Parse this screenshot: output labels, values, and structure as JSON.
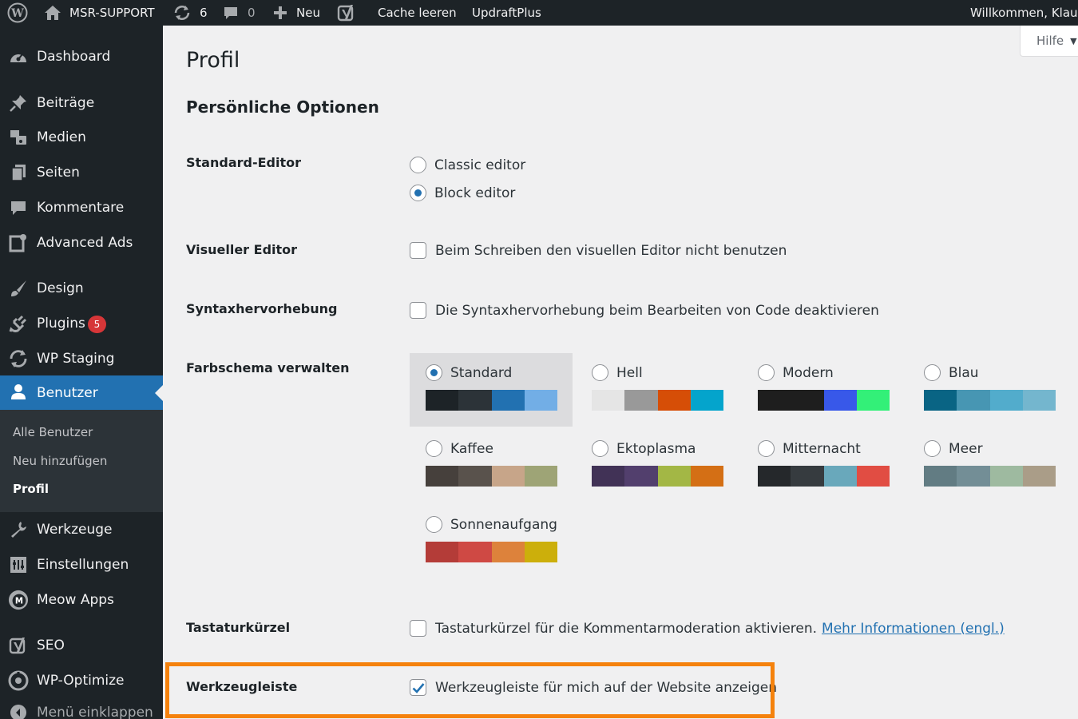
{
  "adminbar": {
    "site_name": "MSR-SUPPORT",
    "updates_count": "6",
    "comments_count": "0",
    "new_label": "Neu",
    "cache_label": "Cache leeren",
    "updraft_label": "UpdraftPlus",
    "welcome": "Willkommen, Klaus"
  },
  "sidebar": {
    "items": [
      {
        "label": "Dashboard",
        "icon": "dashboard-icon"
      },
      {
        "label": "Beiträge",
        "icon": "pin-icon"
      },
      {
        "label": "Medien",
        "icon": "media-icon"
      },
      {
        "label": "Seiten",
        "icon": "pages-icon"
      },
      {
        "label": "Kommentare",
        "icon": "comment-icon"
      },
      {
        "label": "Advanced Ads",
        "icon": "ads-icon"
      },
      {
        "label": "Design",
        "icon": "brush-icon"
      },
      {
        "label": "Plugins",
        "icon": "plugin-icon",
        "badge": "5"
      },
      {
        "label": "WP Staging",
        "icon": "sync-icon"
      },
      {
        "label": "Benutzer",
        "icon": "user-icon"
      },
      {
        "label": "Werkzeuge",
        "icon": "wrench-icon"
      },
      {
        "label": "Einstellungen",
        "icon": "settings-icon"
      },
      {
        "label": "Meow Apps",
        "icon": "meow-icon"
      },
      {
        "label": "SEO",
        "icon": "yoast-icon"
      },
      {
        "label": "WP-Optimize",
        "icon": "optimize-icon"
      },
      {
        "label": "Menü einklappen",
        "icon": "collapse-icon"
      }
    ],
    "submenu": [
      "Alle Benutzer",
      "Neu hinzufügen",
      "Profil"
    ]
  },
  "help_label": "Hilfe",
  "page_title": "Profil",
  "section_title": "Persönliche Optionen",
  "rows": {
    "editor": {
      "label": "Standard-Editor",
      "options": [
        "Classic editor",
        "Block editor"
      ],
      "selected": "Block editor"
    },
    "visual": {
      "label": "Visueller Editor",
      "text": "Beim Schreiben den visuellen Editor nicht benutzen"
    },
    "syntax": {
      "label": "Syntaxhervorhebung",
      "text": "Die Syntaxhervorhebung beim Bearbeiten von Code deaktivieren"
    },
    "colors": {
      "label": "Farbschema verwalten"
    },
    "shortcuts": {
      "label": "Tastaturkürzel",
      "text": "Tastaturkürzel für die Kommentarmoderation aktivieren.",
      "link": "Mehr Informationen (engl.)"
    },
    "toolbar": {
      "label": "Werkzeugleiste",
      "text": "Werkzeugleiste für mich auf der Website anzeigen",
      "checked": true
    }
  },
  "schemes": [
    {
      "name": "Standard",
      "colors": [
        "#1d2327",
        "#2c3338",
        "#2271b1",
        "#72aee6"
      ],
      "selected": true
    },
    {
      "name": "Hell",
      "colors": [
        "#e5e5e5",
        "#999999",
        "#d64e07",
        "#04a4cc"
      ]
    },
    {
      "name": "Modern",
      "colors": [
        "#1e1e1e",
        "#1e1e1e",
        "#3858e9",
        "#33f078"
      ]
    },
    {
      "name": "Blau",
      "colors": [
        "#096484",
        "#4796b3",
        "#52accc",
        "#74b6ce"
      ]
    },
    {
      "name": "Kaffee",
      "colors": [
        "#46403c",
        "#59524c",
        "#c7a589",
        "#9ea476"
      ]
    },
    {
      "name": "Ektoplasma",
      "colors": [
        "#413256",
        "#523f6d",
        "#a3b745",
        "#d46f15"
      ]
    },
    {
      "name": "Mitternacht",
      "colors": [
        "#25282b",
        "#363b3f",
        "#69a8bb",
        "#e14d43"
      ]
    },
    {
      "name": "Meer",
      "colors": [
        "#627c83",
        "#738e96",
        "#9ebaa0",
        "#aa9d88"
      ]
    },
    {
      "name": "Sonnenaufgang",
      "colors": [
        "#b43c38",
        "#cf4944",
        "#dd823b",
        "#ccaf0b"
      ]
    }
  ],
  "colors": {
    "accent": "#2271b1",
    "highlight": "#f5820d",
    "sidebar": "#1d2327"
  }
}
